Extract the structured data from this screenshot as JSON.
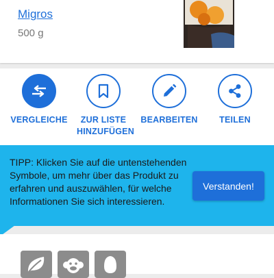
{
  "product": {
    "brand": "Migros",
    "quantity": "500 g"
  },
  "actions": [
    {
      "label": "VERGLEICHE",
      "icon": "compare-arrows-icon"
    },
    {
      "label": "ZUR LISTE HINZUFÜGEN",
      "icon": "bookmark-icon"
    },
    {
      "label": "BEARBEITEN",
      "icon": "pencil-icon"
    },
    {
      "label": "TEILEN",
      "icon": "share-icon"
    }
  ],
  "tip": {
    "text": "TIPP: Klicken Sie auf die untenstehenden Symbole, um mehr über das Produkt zu erfahren und auszuwählen, für welche Informationen Sie sich interessieren.",
    "button_label": "Verstanden!"
  },
  "symbols": [
    "leaf-icon",
    "monkey-icon",
    "egg-icon"
  ],
  "colors": {
    "accent": "#1e6fd9",
    "tip_background": "#1eb4ec",
    "symbol_tile": "#8c8c8c"
  }
}
